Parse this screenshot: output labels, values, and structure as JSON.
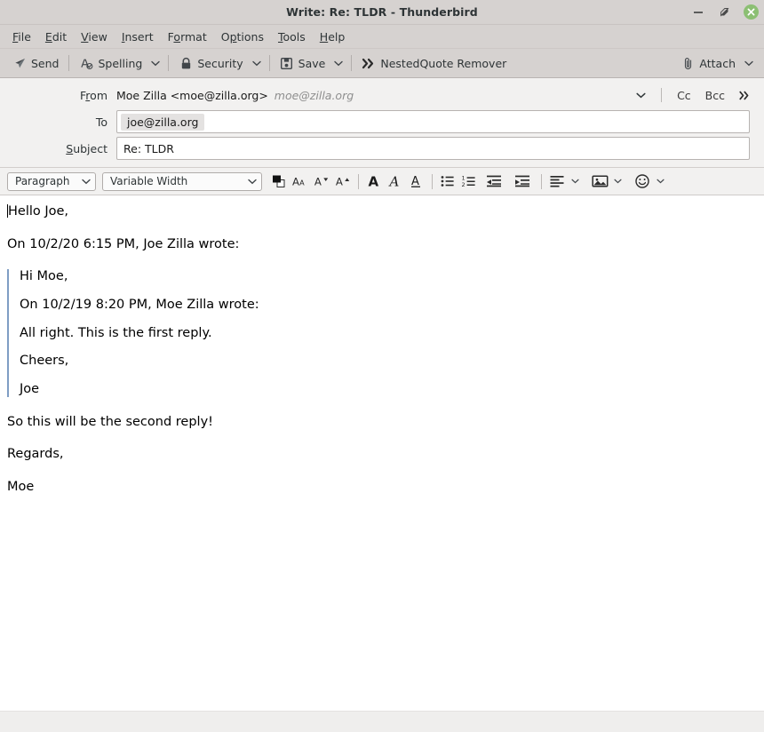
{
  "window": {
    "title": "Write: Re: TLDR - Thunderbird",
    "controls": {
      "minimize": "minimize-button",
      "maximize": "restore-button",
      "close": "close-button",
      "close_color": "#8cbf73"
    }
  },
  "menubar": {
    "items": [
      {
        "label": "File",
        "accesskey": "F"
      },
      {
        "label": "Edit",
        "accesskey": "E"
      },
      {
        "label": "View",
        "accesskey": "V"
      },
      {
        "label": "Insert",
        "accesskey": "I"
      },
      {
        "label": "Format",
        "accesskey": "o"
      },
      {
        "label": "Options",
        "accesskey": "p"
      },
      {
        "label": "Tools",
        "accesskey": "T"
      },
      {
        "label": "Help",
        "accesskey": "H"
      }
    ]
  },
  "toolbar": {
    "send": "Send",
    "spelling": "Spelling",
    "security": "Security",
    "save": "Save",
    "nestedquote_remover": "NestedQuote Remover",
    "attach": "Attach"
  },
  "headers": {
    "from_label": "From",
    "from_accesskey": "r",
    "from_identity": "Moe Zilla <moe@zilla.org>",
    "from_email": "moe@zilla.org",
    "cc_label": "Cc",
    "bcc_label": "Bcc",
    "more_label": "»",
    "to_label": "To",
    "to_recipients": [
      "joe@zilla.org"
    ],
    "subject_label": "Subject",
    "subject_accesskey": "S",
    "subject_value": "Re: TLDR"
  },
  "formatbar": {
    "paragraph_style": "Paragraph",
    "font_face": "Variable Width",
    "text_color_swatch": "#000000"
  },
  "message": {
    "greeting": "Hello Joe,",
    "attribution": "On 10/2/20 6:15 PM, Joe Zilla wrote:",
    "quote": {
      "border_color": "#7f9dc4",
      "lines": [
        "Hi Moe,",
        "On 10/2/19 8:20 PM, Moe Zilla wrote:",
        "All right. This is the first reply.",
        "Cheers,",
        "Joe"
      ]
    },
    "reply_lines": [
      "So this will be the second reply!",
      "Regards,",
      "Moe"
    ]
  },
  "statusbar": {
    "text": ""
  }
}
